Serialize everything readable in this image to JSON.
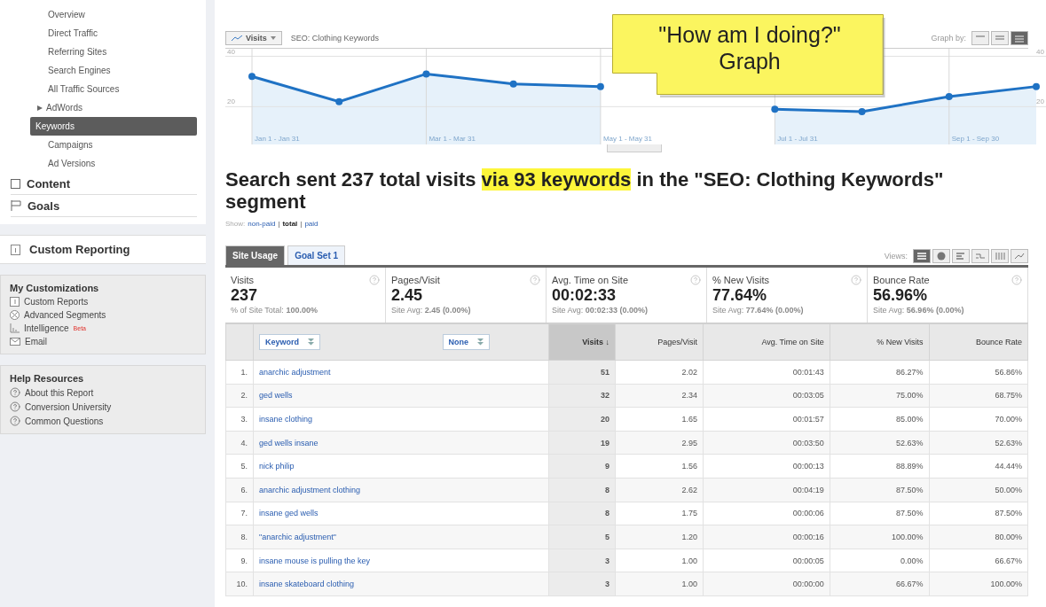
{
  "sidebar": {
    "nav_items": [
      {
        "label": "Overview",
        "selected": false
      },
      {
        "label": "Direct Traffic",
        "selected": false
      },
      {
        "label": "Referring Sites",
        "selected": false
      },
      {
        "label": "Search Engines",
        "selected": false
      },
      {
        "label": "All Traffic Sources",
        "selected": false
      },
      {
        "label": "AdWords",
        "selected": false,
        "expanded": false
      },
      {
        "label": "Keywords",
        "selected": true
      },
      {
        "label": "Campaigns",
        "selected": false
      },
      {
        "label": "Ad Versions",
        "selected": false
      }
    ],
    "sections": [
      {
        "label": "Content",
        "kind": "content"
      },
      {
        "label": "Goals",
        "kind": "goals"
      }
    ],
    "custom_reporting": {
      "label": "Custom Reporting"
    },
    "customizations": {
      "title": "My Customizations",
      "items": [
        {
          "label": "Custom Reports",
          "kind": "report"
        },
        {
          "label": "Advanced Segments",
          "kind": "segments"
        },
        {
          "label": "Intelligence",
          "kind": "intelligence",
          "badge": "Beta"
        },
        {
          "label": "Email",
          "kind": "email"
        }
      ]
    },
    "help": {
      "title": "Help Resources",
      "items": [
        "About this Report",
        "Conversion University",
        "Common Questions"
      ]
    }
  },
  "graph": {
    "segment": "SEO: Clothing Keywords",
    "graph_by_label": "Graph by:",
    "graph_by": [
      {
        "kind": "day",
        "selected": false
      },
      {
        "kind": "week",
        "selected": false
      },
      {
        "kind": "month",
        "selected": true
      }
    ],
    "callout": [
      "\"How am I doing?\"",
      "Graph"
    ],
    "left_axis_labels": [
      "40",
      "20"
    ],
    "right_axis_labels": [
      "40",
      "20"
    ],
    "chart_data": {
      "type": "area",
      "categories": [
        "Jan 1 - Jan 31",
        null,
        "Mar 1 - Mar 31",
        null,
        "May 1 - May 31",
        null,
        "Jul 1 - Jul 31",
        null,
        "Sep 1 - Sep 30",
        null
      ],
      "series": [
        {
          "name": "Visits",
          "color": "#1f72c4",
          "values": [
            32,
            22,
            33,
            29,
            28,
            null,
            19,
            18,
            24,
            28
          ]
        }
      ],
      "ylim": [
        5,
        43
      ],
      "yticks": [
        20,
        40
      ]
    }
  },
  "heading": [
    {
      "text": "Search sent 237 total visits ",
      "highlighted": false
    },
    {
      "text": "via 93 keywords",
      "highlighted": true
    },
    {
      "text": " in the \"SEO: Clothing Keywords\" segment",
      "highlighted": false
    }
  ],
  "show": {
    "label": "Show:",
    "separator": "|",
    "links": [
      {
        "label": "non-paid",
        "selected": false
      },
      {
        "label": "total",
        "selected": true
      },
      {
        "label": "paid",
        "selected": false
      }
    ]
  },
  "tabs": [
    {
      "label": "Site Usage",
      "selected": true
    },
    {
      "label": "Goal Set 1",
      "selected": false
    }
  ],
  "views": {
    "label": "Views:",
    "items": [
      {
        "kind": "table",
        "selected": true
      },
      {
        "kind": "pie",
        "selected": false
      },
      {
        "kind": "bar",
        "selected": false
      },
      {
        "kind": "compare",
        "selected": false
      },
      {
        "kind": "pivot",
        "selected": false
      },
      {
        "kind": "line",
        "selected": false
      }
    ]
  },
  "metrics": [
    {
      "label": "Visits",
      "value": "237",
      "sub": "% of Site Total: **100.00%**"
    },
    {
      "label": "Pages/Visit",
      "value": "2.45",
      "sub": "Site Avg: **2.45 (0.00%)**"
    },
    {
      "label": "Avg. Time on Site",
      "value": "00:02:33",
      "sub": "Site Avg: **00:02:33 (0.00%)**"
    },
    {
      "label": "% New Visits",
      "value": "77.64%",
      "sub": "Site Avg: **77.64% (0.00%)**"
    },
    {
      "label": "Bounce Rate",
      "value": "56.96%",
      "sub": "Site Avg: **56.96% (0.00%)**"
    }
  ],
  "table": {
    "columns": [
      {
        "kind": "blank"
      },
      {
        "kind": "dimensions",
        "dropdowns": [
          "Keyword",
          "None"
        ]
      },
      {
        "kind": "metric",
        "label": "Visits ↓",
        "sorted": true
      },
      {
        "kind": "metric",
        "label": "Pages/Visit",
        "sorted": false
      },
      {
        "kind": "metric",
        "label": "Avg. Time on Site",
        "sorted": false
      },
      {
        "kind": "metric",
        "label": "% New Visits",
        "sorted": false
      },
      {
        "kind": "metric",
        "label": "Bounce Rate",
        "sorted": false
      }
    ],
    "rows": [
      [
        "1.",
        "anarchic adjustment",
        "51",
        "2.02",
        "00:01:43",
        "86.27%",
        "56.86%"
      ],
      [
        "2.",
        "ged wells",
        "32",
        "2.34",
        "00:03:05",
        "75.00%",
        "68.75%"
      ],
      [
        "3.",
        "insane clothing",
        "20",
        "1.65",
        "00:01:57",
        "85.00%",
        "70.00%"
      ],
      [
        "4.",
        "ged wells insane",
        "19",
        "2.95",
        "00:03:50",
        "52.63%",
        "52.63%"
      ],
      [
        "5.",
        "nick philip",
        "9",
        "1.56",
        "00:00:13",
        "88.89%",
        "44.44%"
      ],
      [
        "6.",
        "anarchic adjustment clothing",
        "8",
        "2.62",
        "00:04:19",
        "87.50%",
        "50.00%"
      ],
      [
        "7.",
        "insane ged wells",
        "8",
        "1.75",
        "00:00:06",
        "87.50%",
        "87.50%"
      ],
      [
        "8.",
        "\"anarchic adjustment\"",
        "5",
        "1.20",
        "00:00:16",
        "100.00%",
        "80.00%"
      ],
      [
        "9.",
        "insane mouse is pulling the key",
        "3",
        "1.00",
        "00:00:05",
        "0.00%",
        "66.67%"
      ],
      [
        "10.",
        "insane skateboard clothing",
        "3",
        "1.00",
        "00:00:00",
        "66.67%",
        "100.00%"
      ]
    ]
  }
}
